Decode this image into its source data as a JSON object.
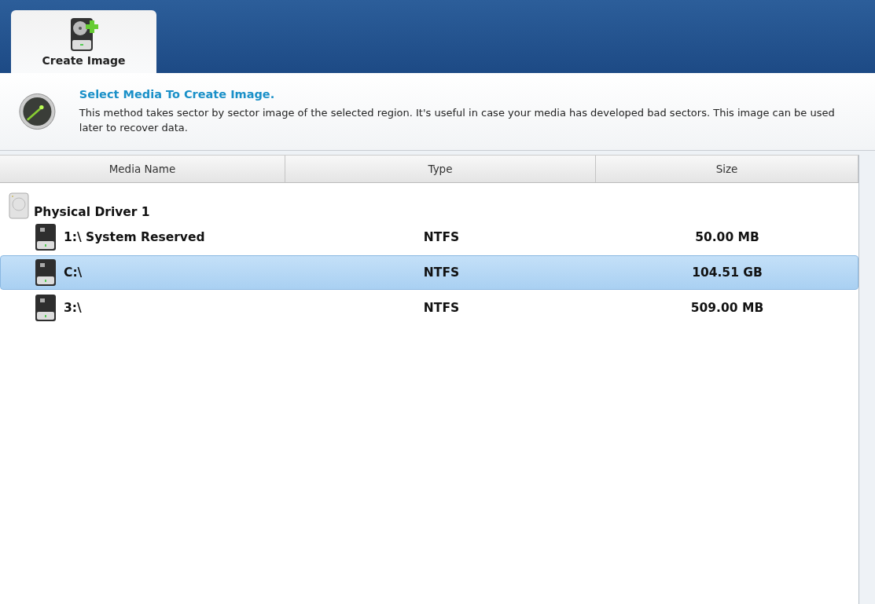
{
  "tabs": [
    {
      "label": "Create Image",
      "selected": true
    }
  ],
  "header": {
    "title": "Select Media To Create Image.",
    "description": "This method takes sector by sector image of the selected region. It's useful in case your media has developed bad sectors. This image can be used later to recover data."
  },
  "table": {
    "columns": [
      "Media Name",
      "Type",
      "Size"
    ],
    "groups": [
      {
        "name": "Physical Driver 1",
        "children": [
          {
            "name": "1:\\ System Reserved",
            "type": "NTFS",
            "size": "50.00 MB",
            "selected": false
          },
          {
            "name": "C:\\",
            "type": "NTFS",
            "size": "104.51 GB",
            "selected": true
          },
          {
            "name": "3:\\",
            "type": "NTFS",
            "size": "509.00 MB",
            "selected": false
          }
        ]
      }
    ]
  }
}
